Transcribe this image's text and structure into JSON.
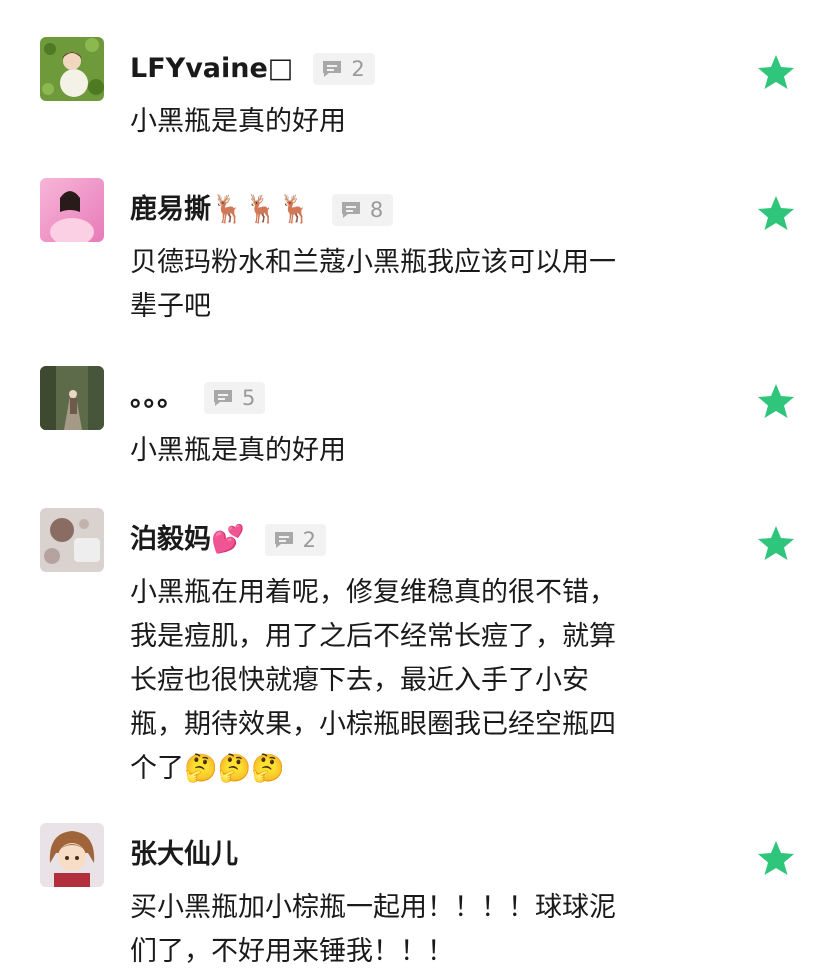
{
  "comments": [
    {
      "name": "LFYvaine□",
      "count": "2",
      "text": [
        "小黑瓶是真的好用"
      ],
      "starred": true
    },
    {
      "name": "鹿易撕🦌🦌🦌",
      "count": "8",
      "text": [
        "贝德玛粉水和兰蔻小黑瓶我应该可以用一",
        "辈子吧"
      ],
      "starred": true
    },
    {
      "name": "。。。",
      "count": "5",
      "text": [
        "小黑瓶是真的好用"
      ],
      "starred": true
    },
    {
      "name": "泊毅妈💕",
      "count": "2",
      "text": [
        "小黑瓶在用着呢，修复维稳真的很不错，",
        "我是痘肌，用了之后不经常长痘了，就算",
        "长痘也很快就瘪下去，最近入手了小安",
        "瓶，期待效果，小棕瓶眼圈我已经空瓶四",
        "个了🤔🤔🤔"
      ],
      "starred": true
    },
    {
      "name": "张大仙儿",
      "count": null,
      "text": [
        "买小黑瓶加小棕瓶一起用！！！！球球泥",
        "们了，不好用来锤我！！！"
      ],
      "starred": true
    }
  ],
  "colors": {
    "star": "#2fc57a",
    "badge_bg": "#f2f2f2",
    "badge_text": "#9a9a9a",
    "text": "#1a1a1a"
  },
  "icons": {
    "badge": "comment-bubble-icon",
    "favorite": "star-icon"
  }
}
